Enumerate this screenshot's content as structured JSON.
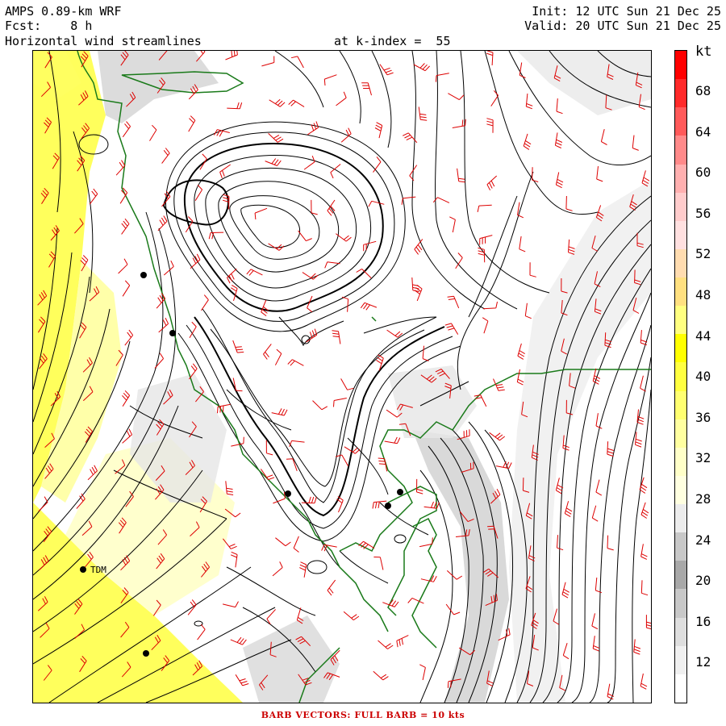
{
  "header": {
    "model": "AMPS 0.89-km WRF",
    "fcst": "Fcst:    8 h",
    "field": "Horizontal wind streamlines",
    "level": "at k-index =  55",
    "init": "Init: 12 UTC Sun 21 Dec 25",
    "valid": "Valid: 20 UTC Sun 21 Dec 25"
  },
  "colorbar": {
    "unit": "kt",
    "labels": [
      "68",
      "64",
      "60",
      "56",
      "52",
      "48",
      "44",
      "40",
      "36",
      "32",
      "28",
      "24",
      "20",
      "16",
      "12"
    ],
    "colors": [
      "#ff0000",
      "#ff2a2a",
      "#ff5a5a",
      "#ff8a8a",
      "#ffb0b0",
      "#ffcccc",
      "#ffe0e0",
      "#ffdcb0",
      "#ffe080",
      "#ffff80",
      "#ffff00",
      "#ffff40",
      "#ffff70",
      "#ffffa0",
      "#ffffc8",
      "#ffffe0",
      "#ececec",
      "#c8c8c8",
      "#a8a8a8",
      "#c8c8c8",
      "#dedede",
      "#f0f0f0",
      "#ffffff"
    ]
  },
  "map": {
    "station_label": "TDM",
    "colors": {
      "coast": "#1a7a1a",
      "barb": "#dd0000",
      "stream": "#000000",
      "shade_yellow": "#ffff00",
      "shade_gray": "#d0d0d0"
    }
  },
  "footer": "BARB VECTORS:  FULL BARB = 10 kts"
}
